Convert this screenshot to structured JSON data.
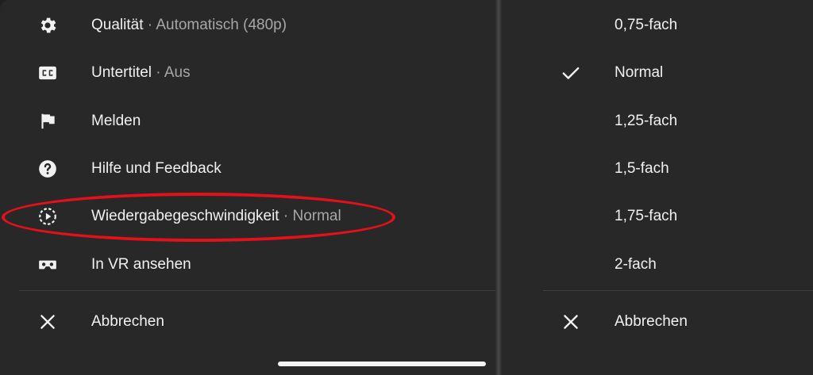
{
  "left_menu": {
    "items": [
      {
        "icon": "gear-icon",
        "label": "Qualität",
        "separator": " · ",
        "value": "Automatisch (480p)"
      },
      {
        "icon": "closed-captions-icon",
        "label": "Untertitel",
        "separator": " · ",
        "value": "Aus"
      },
      {
        "icon": "flag-icon",
        "label": "Melden",
        "separator": "",
        "value": ""
      },
      {
        "icon": "help-icon",
        "label": "Hilfe und Feedback",
        "separator": "",
        "value": ""
      },
      {
        "icon": "playback-speed-icon",
        "label": "Wiedergabegeschwindigkeit",
        "separator": " · ",
        "value": "Normal"
      },
      {
        "icon": "vr-headset-icon",
        "label": "In VR ansehen",
        "separator": "",
        "value": ""
      }
    ],
    "cancel": {
      "icon": "close-icon",
      "label": "Abbrechen"
    }
  },
  "speed_menu": {
    "options": [
      {
        "label": "0,75-fach",
        "selected": false
      },
      {
        "label": "Normal",
        "selected": true
      },
      {
        "label": "1,25-fach",
        "selected": false
      },
      {
        "label": "1,5-fach",
        "selected": false
      },
      {
        "label": "1,75-fach",
        "selected": false
      },
      {
        "label": "2-fach",
        "selected": false
      }
    ],
    "selected_icon": "checkmark-icon",
    "cancel": {
      "icon": "close-icon",
      "label": "Abbrechen"
    }
  },
  "colors": {
    "panel_background": "#282828",
    "text_primary": "#f1f1f1",
    "text_secondary": "#a7a7a7",
    "highlight": "#e4101a"
  }
}
